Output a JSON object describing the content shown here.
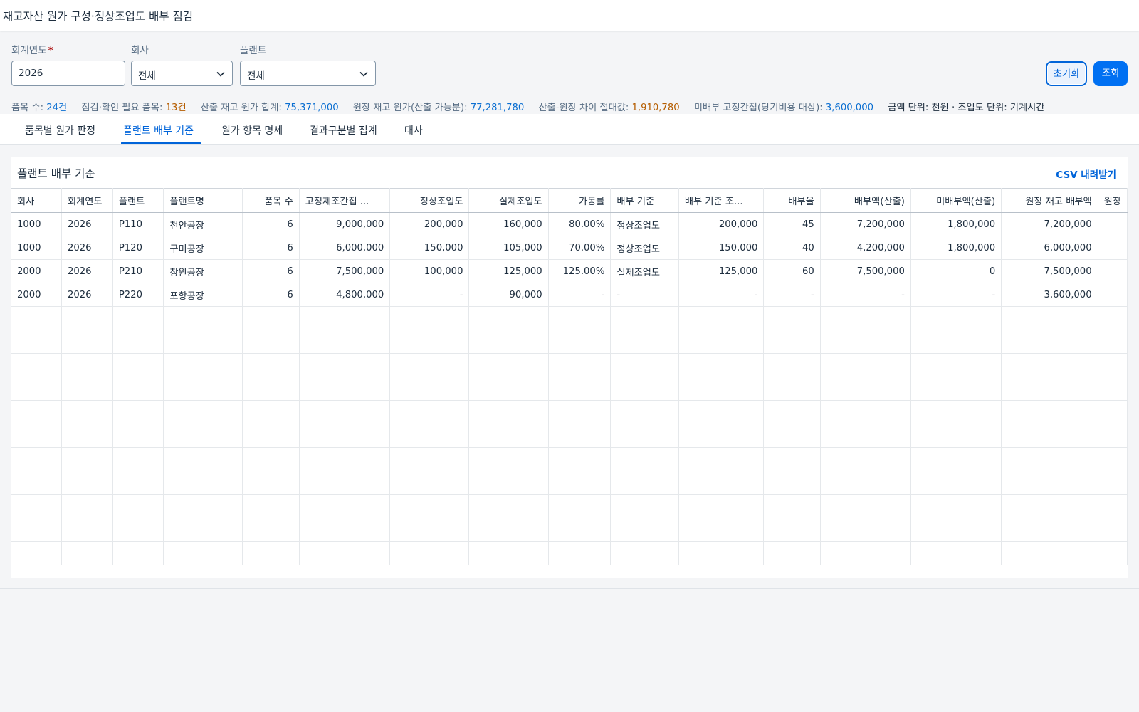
{
  "header": {
    "title": "재고자산 원가 구성·정상조업도 배부 점검"
  },
  "filters": {
    "year": {
      "label": "회계연도",
      "required_mark": "*",
      "value": "2026"
    },
    "company": {
      "label": "회사",
      "value": "전체"
    },
    "plant": {
      "label": "플랜트",
      "value": "전체"
    }
  },
  "buttons": {
    "reset": "초기화",
    "search": "조회"
  },
  "stats": {
    "items_label": "품목 수:",
    "items_value": "24건",
    "check_label": "점검·확인 필요 품목:",
    "check_value": "13건",
    "calc_label": "산출 재고 원가 합계:",
    "calc_value": "75,371,000",
    "ledger_label": "원장 재고 원가(산출 가능분):",
    "ledger_value": "77,281,780",
    "diff_label": "산출-원장 차이 절대값:",
    "diff_value": "1,910,780",
    "unalloc_label": "미배부 고정간접(당기비용 대상):",
    "unalloc_value": "3,600,000",
    "unit_text": "금액 단위: 천원 · 조업도 단위: 기계시간"
  },
  "tabs": [
    {
      "label": "품목별 원가 판정",
      "active": false
    },
    {
      "label": "플랜트 배부 기준",
      "active": true
    },
    {
      "label": "원가 항목 명세",
      "active": false
    },
    {
      "label": "결과구분별 집계",
      "active": false
    },
    {
      "label": "대사",
      "active": false
    }
  ],
  "panel": {
    "title": "플랜트 배부 기준",
    "csv_label": "CSV 내려받기"
  },
  "table": {
    "columns": [
      "회사",
      "회계연도",
      "플랜트",
      "플랜트명",
      "품목 수",
      "고정제조간접 ...",
      "정상조업도",
      "실제조업도",
      "가동률",
      "배부 기준",
      "배부 기준 조...",
      "배부율",
      "배부액(산출)",
      "미배부액(산출)",
      "원장 재고 배부액",
      "원장"
    ],
    "rows": [
      [
        "1000",
        "2026",
        "P110",
        "천안공장",
        "6",
        "9,000,000",
        "200,000",
        "160,000",
        "80.00%",
        "정상조업도",
        "200,000",
        "45",
        "7,200,000",
        "1,800,000",
        "7,200,000",
        ""
      ],
      [
        "1000",
        "2026",
        "P120",
        "구미공장",
        "6",
        "6,000,000",
        "150,000",
        "105,000",
        "70.00%",
        "정상조업도",
        "150,000",
        "40",
        "4,200,000",
        "1,800,000",
        "6,000,000",
        ""
      ],
      [
        "2000",
        "2026",
        "P210",
        "창원공장",
        "6",
        "7,500,000",
        "100,000",
        "125,000",
        "125.00%",
        "실제조업도",
        "125,000",
        "60",
        "7,500,000",
        "0",
        "7,500,000",
        ""
      ],
      [
        "2000",
        "2026",
        "P220",
        "포항공장",
        "6",
        "4,800,000",
        "-",
        "90,000",
        "-",
        "-",
        "-",
        "-",
        "-",
        "-",
        "3,600,000",
        ""
      ]
    ],
    "empty_rows": 11
  },
  "icons": {
    "chevron": "chevron-down-icon"
  },
  "colors": {
    "accent": "#0064d9",
    "primary_button": "#0070f2",
    "stat_value": "#0a6ed1",
    "warning_value": "#b55d00"
  }
}
